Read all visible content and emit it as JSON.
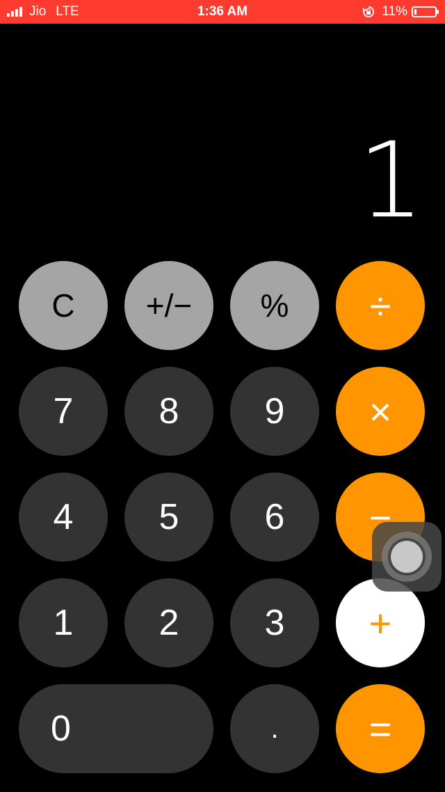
{
  "status_bar": {
    "carrier": "Jio",
    "network": "LTE",
    "time": "1:36 AM",
    "battery_percent": "11%",
    "battery_level": 0.11,
    "background_color": "#ff3b30"
  },
  "display": {
    "value": "1"
  },
  "keys": {
    "clear": "C",
    "sign": "+/−",
    "percent": "%",
    "divide": "÷",
    "seven": "7",
    "eight": "8",
    "nine": "9",
    "multiply": "×",
    "four": "4",
    "five": "5",
    "six": "6",
    "subtract": "−",
    "one": "1",
    "two": "2",
    "three": "3",
    "add": "+",
    "zero": "0",
    "decimal": ".",
    "equals": "="
  },
  "colors": {
    "function_key": "#a5a5a5",
    "number_key": "#333333",
    "operator_key": "#ff9500",
    "active_operator_key": "#ffffff"
  },
  "active_operator": "add",
  "icons": {
    "signal": "signal-bars-icon",
    "rotation_lock": "rotation-lock-icon",
    "battery": "battery-icon",
    "assistive_touch": "assistive-touch-icon"
  }
}
